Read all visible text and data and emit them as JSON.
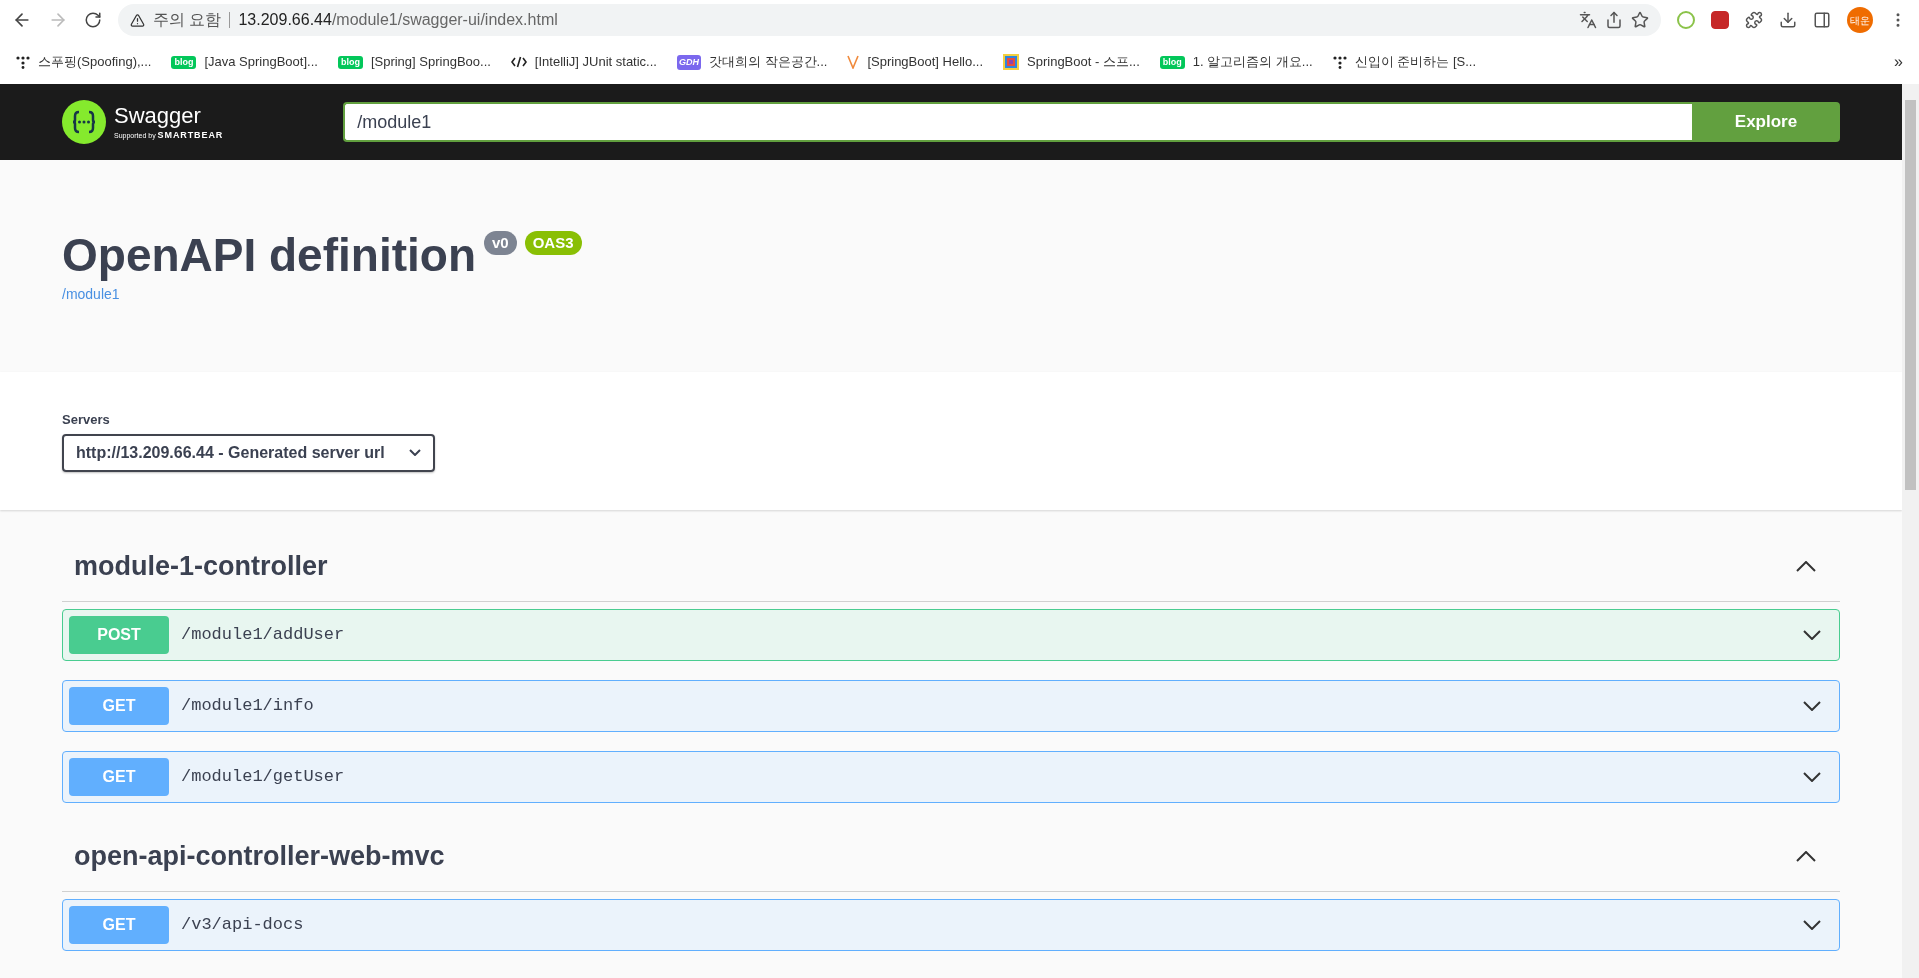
{
  "browser": {
    "security": "주의 요함",
    "url_host": "13.209.66.44",
    "url_path": "/module1/swagger-ui/index.html",
    "profile": "태운",
    "bookmarks": [
      {
        "kind": "dots",
        "label": "스푸핑(Spoofing),..."
      },
      {
        "kind": "blog",
        "icon_text": "blog",
        "label": "[Java SpringBoot]..."
      },
      {
        "kind": "blog",
        "icon_text": "blog",
        "label": "[Spring] SpringBoo..."
      },
      {
        "kind": "code",
        "label": "[IntelliJ] JUnit static..."
      },
      {
        "kind": "gdh",
        "icon_text": "GDH",
        "label": "갓대희의 작은공간..."
      },
      {
        "kind": "vee",
        "label": "[SpringBoot] Hello..."
      },
      {
        "kind": "squares",
        "label": "SpringBoot - 스프..."
      },
      {
        "kind": "blog",
        "icon_text": "blog",
        "label": "1. 알고리즘의 개요..."
      },
      {
        "kind": "dots",
        "label": "신입이 준비하는 [S..."
      }
    ],
    "more": "»"
  },
  "topbar": {
    "logo_name": "Swagger",
    "logo_sub": "Supported by",
    "logo_brand": "SMARTBEAR",
    "url_value": "/module1",
    "explore": "Explore"
  },
  "info": {
    "title": "OpenAPI definition",
    "version": "v0",
    "spec": "OAS3",
    "base_url": "/module1"
  },
  "servers": {
    "label": "Servers",
    "selected": "http://13.209.66.44 - Generated server url"
  },
  "tags": [
    {
      "name": "module-1-controller",
      "expanded": true,
      "operations": [
        {
          "method": "POST",
          "path": "/module1/addUser"
        },
        {
          "method": "GET",
          "path": "/module1/info"
        },
        {
          "method": "GET",
          "path": "/module1/getUser"
        }
      ]
    },
    {
      "name": "open-api-controller-web-mvc",
      "expanded": true,
      "operations": [
        {
          "method": "GET",
          "path": "/v3/api-docs"
        }
      ]
    }
  ]
}
